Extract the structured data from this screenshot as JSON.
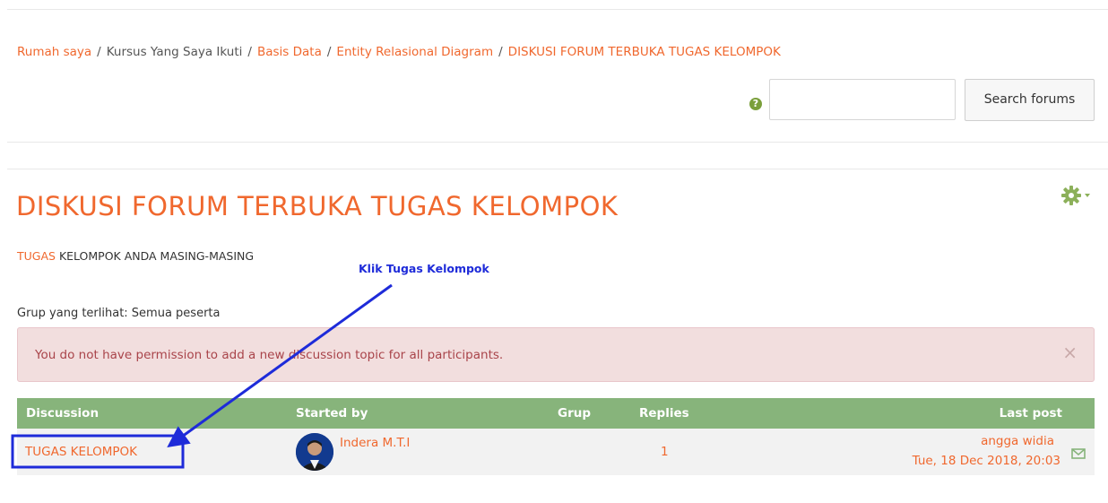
{
  "breadcrumb": {
    "items": [
      "Rumah saya",
      "Kursus Yang Saya Ikuti",
      "Basis Data",
      "Entity Relasional Diagram",
      "DISKUSI FORUM TERBUKA TUGAS KELOMPOK"
    ],
    "separator": "/"
  },
  "search": {
    "placeholder": "",
    "value": "",
    "button_label": "Search forums",
    "help_icon": "question-circle-icon"
  },
  "page": {
    "title": "DISKUSI FORUM TERBUKA TUGAS KELOMPOK",
    "settings_icon": "gear-icon",
    "intro_link": "TUGAS",
    "intro_rest": " KELOMPOK ANDA MASING-MASING"
  },
  "annotation": {
    "text": "Klik Tugas Kelompok",
    "color": "#1e2bd9"
  },
  "groups": {
    "label": "Grup yang terlihat: Semua peserta"
  },
  "alert": {
    "message": "You do not have permission to add a new discussion topic for all participants.",
    "close": "×"
  },
  "table": {
    "headers": [
      "Discussion",
      "Started by",
      "Grup",
      "Replies",
      "Last post"
    ],
    "rows": [
      {
        "discussion": "TUGAS KELOMPOK",
        "started_by": "Indera M.T.I",
        "group": "",
        "replies": "1",
        "last_post_author": "angga widia",
        "last_post_date": "Tue, 18 Dec 2018, 20:03",
        "mail_icon": "envelope-icon"
      }
    ]
  },
  "colors": {
    "accent": "#f0682e",
    "table_header": "#87b47b",
    "alert_bg": "#f2dede",
    "alert_text": "#a9444a"
  }
}
